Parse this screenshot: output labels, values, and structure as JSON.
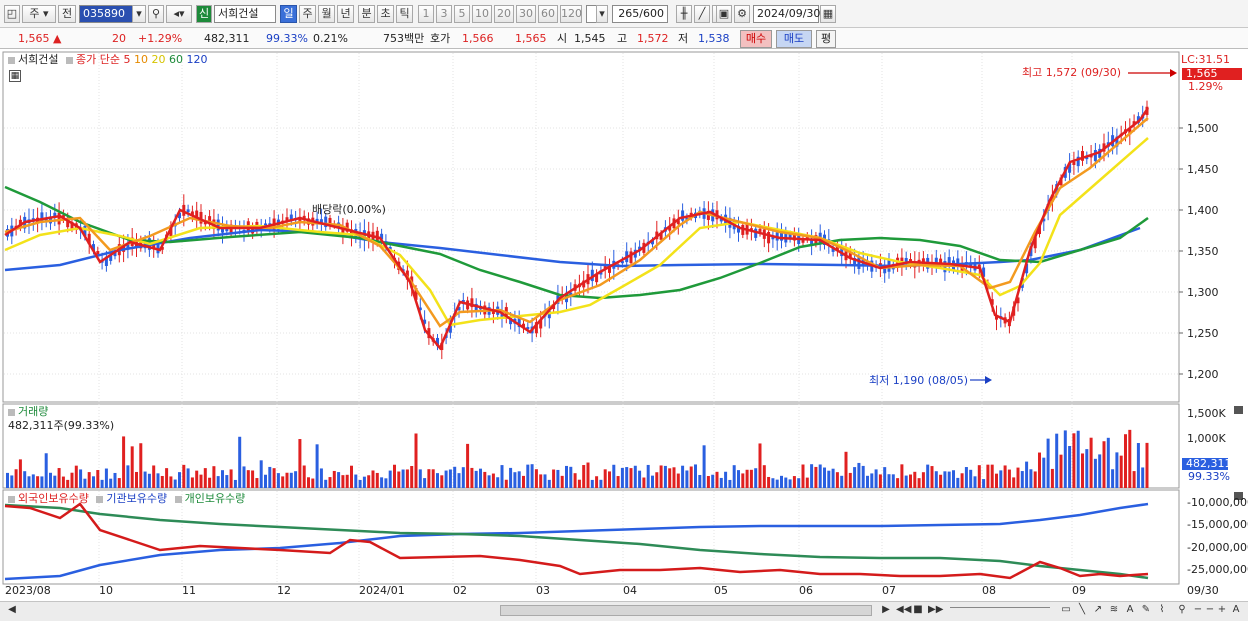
{
  "toolbar": {
    "period_jo": "주",
    "prev_label": "전",
    "code": "035890",
    "sin": "신",
    "name": "서희건설",
    "periods": [
      "일",
      "주",
      "월",
      "년",
      "분",
      "초",
      "틱"
    ],
    "minutes": [
      "1",
      "3",
      "5",
      "10",
      "20",
      "30",
      "60",
      "120"
    ],
    "count": "265",
    "count_total": "/600",
    "date": "2024/09/30"
  },
  "quote": {
    "price": "1,565 ▲",
    "change": "20",
    "change_pct": "+1.29%",
    "volume": "482,311",
    "vol_ratio": "99.33%",
    "turnover": "0.21%",
    "amount": "753백만",
    "hoga_label": "호가",
    "ask": "1,566",
    "bid": "1,565",
    "open_label": "시",
    "open": "1,545",
    "high_label": "고",
    "high": "1,572",
    "low_label": "저",
    "low": "1,538",
    "buy_label": "매수",
    "sell_label": "매도",
    "eval_label": "평"
  },
  "price_panel": {
    "name_label": "서희건설",
    "ma_label": "종가 단순",
    "ma_periods": [
      "5",
      "10",
      "20",
      "60",
      "120"
    ],
    "ma_colors": [
      "#e02020",
      "#f39a1f",
      "#f3e21a",
      "#1f9a3a",
      "#2a5fe0"
    ],
    "lc": "LC:31.51",
    "last_price": "1,565",
    "last_pct": "1.29%",
    "high_annot": "최고 1,572 (09/30)",
    "low_annot": "최저 1,190 (08/05)",
    "dividend_annot": "배당락(0.00%)",
    "y_ticks": [
      "1,500",
      "1,450",
      "1,400",
      "1,350",
      "1,300",
      "1,250",
      "1,200"
    ]
  },
  "volume_panel": {
    "title": "거래량",
    "value_label": "482,311주(99.33%)",
    "y_ticks": [
      "1,500K",
      "1,000K"
    ],
    "last_value": "482,311",
    "last_pct": "99.33%"
  },
  "holdings_panel": {
    "items": [
      {
        "label": "외국인보유수량",
        "color": "#d41b1b"
      },
      {
        "label": "기관보유수량",
        "color": "#2a5fe0"
      },
      {
        "label": "개인보유수량",
        "color": "#2e8b57"
      }
    ],
    "y_ticks": [
      "-10,000,000",
      "-15,000,000",
      "-20,000,000",
      "-25,000,000"
    ]
  },
  "x_axis": {
    "labels": [
      "2023/08",
      "10",
      "11",
      "12",
      "2024/01",
      "02",
      "03",
      "04",
      "05",
      "06",
      "07",
      "08",
      "09"
    ],
    "right_label": "09/30"
  },
  "chart_data": {
    "type": "candlestick",
    "series": [
      {
        "name": "종가",
        "points": [
          [
            "2023/08",
            1380
          ],
          [
            "2023/09",
            1370
          ],
          [
            "2023/10",
            1360
          ],
          [
            "2023/11",
            1390
          ],
          [
            "2023/12",
            1375
          ],
          [
            "2024/01",
            1330
          ],
          [
            "2024/01(late)",
            1230
          ],
          [
            "2024/02",
            1280
          ],
          [
            "2024/03",
            1310
          ],
          [
            "2024/04",
            1370
          ],
          [
            "2024/05",
            1390
          ],
          [
            "2024/06",
            1360
          ],
          [
            "2024/07",
            1330
          ],
          [
            "2024/08/05",
            1190
          ],
          [
            "2024/08",
            1420
          ],
          [
            "2024/09",
            1500
          ],
          [
            "2024/09/30",
            1565
          ]
        ]
      }
    ],
    "ylim": [
      1180,
      1590
    ],
    "annotations": [
      "최고 1,572 (09/30)",
      "최저 1,190 (08/05)",
      "배당락(0.00%)"
    ]
  }
}
